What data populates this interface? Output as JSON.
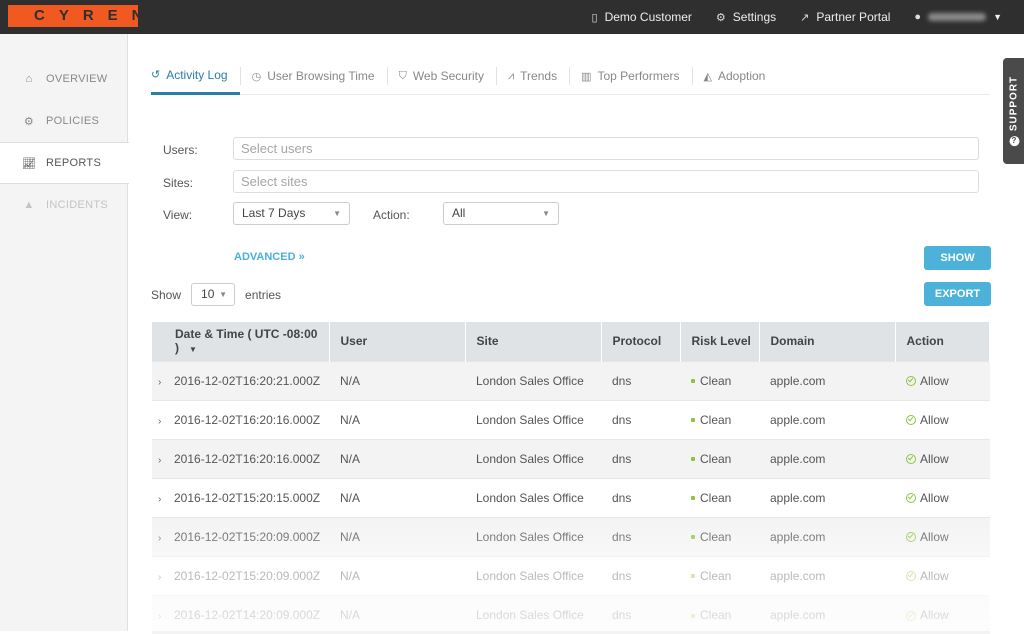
{
  "brand": {
    "logo_text": "CYREN",
    "accent": "#f05a22"
  },
  "topnav": {
    "customer_label": "Demo Customer",
    "settings_label": "Settings",
    "partner_portal_label": "Partner Portal",
    "user_name_obscured": true
  },
  "sidebar": {
    "items": [
      {
        "label": "OVERVIEW",
        "icon": "home-icon",
        "state": "normal"
      },
      {
        "label": "POLICIES",
        "icon": "cogs-icon",
        "state": "normal"
      },
      {
        "label": "REPORTS",
        "icon": "line-chart-icon",
        "state": "active"
      },
      {
        "label": "INCIDENTS",
        "icon": "warning-icon",
        "state": "disabled"
      }
    ]
  },
  "support_tab": {
    "label": "SUPPORT",
    "icon": "question-circle-icon"
  },
  "tabs": [
    {
      "label": "Activity Log",
      "icon": "history-icon",
      "active": true
    },
    {
      "label": "User Browsing Time",
      "icon": "clock-icon",
      "active": false
    },
    {
      "label": "Web Security",
      "icon": "shield-icon",
      "active": false
    },
    {
      "label": "Trends",
      "icon": "line-chart-icon",
      "active": false
    },
    {
      "label": "Top Performers",
      "icon": "bar-chart-icon",
      "active": false
    },
    {
      "label": "Adoption",
      "icon": "area-chart-icon",
      "active": false
    }
  ],
  "filters": {
    "users_label": "Users:",
    "users_placeholder": "Select users",
    "sites_label": "Sites:",
    "sites_placeholder": "Select sites",
    "view_label": "View:",
    "view_value": "Last 7 Days",
    "action_label": "Action:",
    "action_value": "All",
    "advanced_label": "ADVANCED »",
    "show_button": "SHOW",
    "export_button": "EXPORT"
  },
  "entries": {
    "show_label": "Show",
    "value": "10",
    "entries_label": "entries"
  },
  "table": {
    "columns": [
      "Date & Time ( UTC -08:00 )",
      "User",
      "Site",
      "Protocol",
      "Risk Level",
      "Domain",
      "Action"
    ],
    "sort_column": "Date & Time ( UTC -08:00 )",
    "sort_direction": "desc",
    "rows": [
      {
        "datetime": "2016-12-02T16:20:21.000Z",
        "user": "N/A",
        "site": "London Sales Office",
        "protocol": "dns",
        "risk": "Clean",
        "domain": "apple.com",
        "action": "Allow"
      },
      {
        "datetime": "2016-12-02T16:20:16.000Z",
        "user": "N/A",
        "site": "London Sales Office",
        "protocol": "dns",
        "risk": "Clean",
        "domain": "apple.com",
        "action": "Allow"
      },
      {
        "datetime": "2016-12-02T16:20:16.000Z",
        "user": "N/A",
        "site": "London Sales Office",
        "protocol": "dns",
        "risk": "Clean",
        "domain": "apple.com",
        "action": "Allow"
      },
      {
        "datetime": "2016-12-02T15:20:15.000Z",
        "user": "N/A",
        "site": "London Sales Office",
        "protocol": "dns",
        "risk": "Clean",
        "domain": "apple.com",
        "action": "Allow"
      },
      {
        "datetime": "2016-12-02T15:20:09.000Z",
        "user": "N/A",
        "site": "London Sales Office",
        "protocol": "dns",
        "risk": "Clean",
        "domain": "apple.com",
        "action": "Allow"
      },
      {
        "datetime": "2016-12-02T15:20:09.000Z",
        "user": "N/A",
        "site": "London Sales Office",
        "protocol": "dns",
        "risk": "Clean",
        "domain": "apple.com",
        "action": "Allow"
      },
      {
        "datetime": "2016-12-02T14:20:09.000Z",
        "user": "N/A",
        "site": "London Sales Office",
        "protocol": "dns",
        "risk": "Clean",
        "domain": "apple.com",
        "action": "Allow"
      }
    ]
  },
  "colors": {
    "primary": "#4cb2d9",
    "active_tab": "#2a7fa8",
    "clean": "#8cc63f",
    "topbar": "#2f2f2f"
  }
}
